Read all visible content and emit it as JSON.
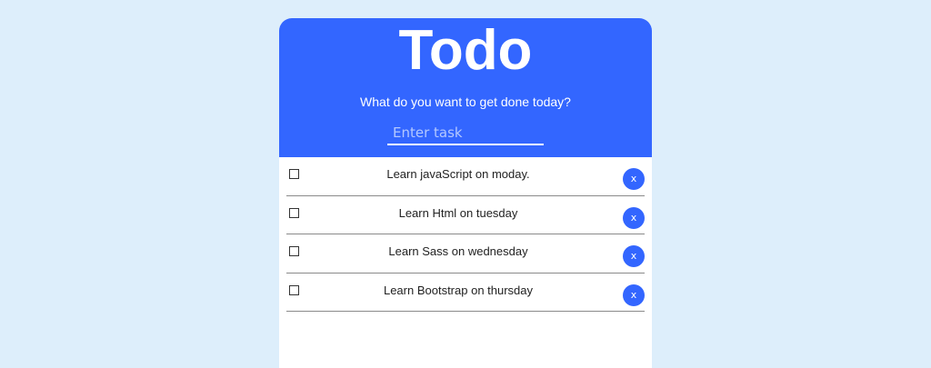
{
  "header": {
    "title": "Todo",
    "subtitle": "What do you want to get done today?",
    "input_placeholder": "Enter task",
    "input_value": ""
  },
  "todos": [
    {
      "text": "Learn javaScript on moday.",
      "checked": false,
      "delete_label": "x"
    },
    {
      "text": "Learn Html on tuesday",
      "checked": false,
      "delete_label": "x"
    },
    {
      "text": "Learn Sass on wednesday",
      "checked": false,
      "delete_label": "x"
    },
    {
      "text": "Learn Bootstrap on thursday",
      "checked": false,
      "delete_label": "x"
    }
  ],
  "colors": {
    "accent": "#3366ff",
    "page_background": "#ddeefb",
    "card_background": "#ffffff"
  }
}
